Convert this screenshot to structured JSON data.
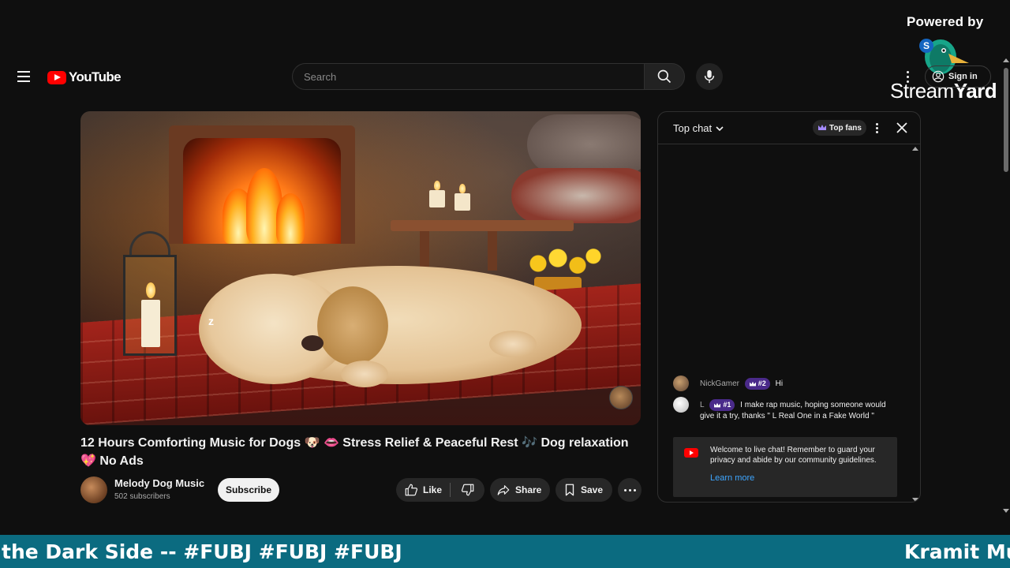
{
  "overlay": {
    "powered_by": "Powered by",
    "streamyard_left": "Stream",
    "streamyard_right": "Yard"
  },
  "header": {
    "logo_text": "YouTube",
    "search_placeholder": "Search",
    "sign_in": "Sign in"
  },
  "video": {
    "title": "12 Hours Comforting Music for Dogs 🐶 👄 Stress Relief & Peaceful Rest 🎶 Dog relaxation 💖 No Ads",
    "zzz": "z"
  },
  "channel": {
    "name": "Melody Dog Music",
    "subscribers": "502 subscribers",
    "subscribe_label": "Subscribe"
  },
  "actions": {
    "like": "Like",
    "share": "Share",
    "save": "Save"
  },
  "chat": {
    "mode_label": "Top chat",
    "top_fans_label": "Top fans",
    "messages": [
      {
        "author": "NickGamer",
        "badge": "#2",
        "text": "Hi"
      },
      {
        "author": "L",
        "badge": "#1",
        "text": "I make rap music, hoping someone would give it a try, thanks \" L Real One in a Fake World \""
      }
    ],
    "welcome": {
      "text": "Welcome to live chat! Remember to guard your privacy and abide by our community guidelines.",
      "learn_more": "Learn more"
    }
  },
  "ticker": {
    "left_text": "the Dark Side -- #FUBJ #FUBJ #FUBJ",
    "right_text": "Kramit Mu"
  },
  "colors": {
    "background": "#0f0f0f",
    "accent_red": "#ff0000",
    "link_blue": "#3ea6ff",
    "ticker_teal": "#0b6b80",
    "badge_purple": "#4a2a8a"
  }
}
